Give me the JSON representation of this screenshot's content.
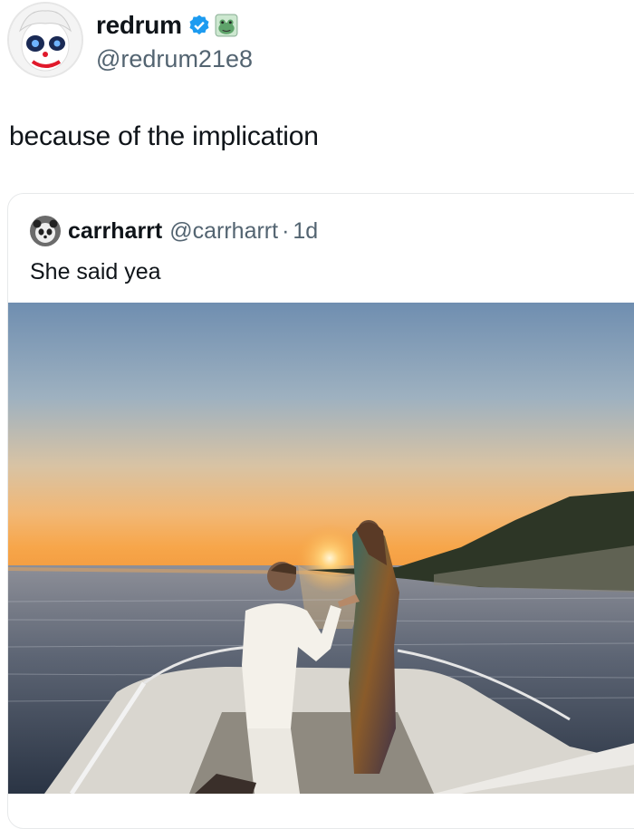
{
  "tweet": {
    "display_name": "redrum",
    "handle": "@redrum21e8",
    "text": "because of the implication",
    "avatar_icon": "clown-avatar-icon",
    "badges": [
      "verified-badge-icon",
      "frog-emoji-icon"
    ]
  },
  "quoted": {
    "display_name": "carrharrt",
    "handle": "@carrharrt",
    "separator": "·",
    "time": "1d",
    "text": "She said yea",
    "avatar_icon": "panda-avatar-icon"
  },
  "colors": {
    "verified": "#1d9bf0",
    "handle": "#536471",
    "text": "#0f1419",
    "border": "#e7e9ea"
  }
}
